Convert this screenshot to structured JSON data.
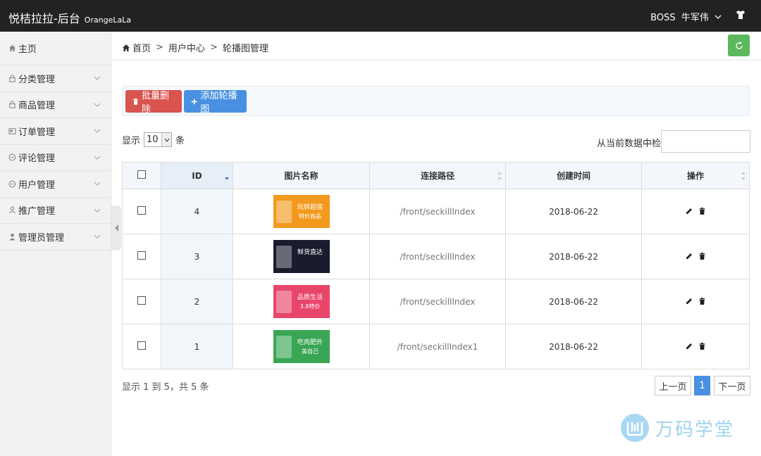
{
  "brand": {
    "title": "悦桔拉拉-后台",
    "subtitle": "OrangeLaLa"
  },
  "user": {
    "role": "BOSS",
    "name": "牛军伟"
  },
  "icons": {
    "shirt": "tshirt-icon",
    "home": "home-icon",
    "lock": "lock-icon",
    "order": "order-icon",
    "comment": "comment-icon",
    "person": "user-icon",
    "refresh": "refresh-icon",
    "trash": "trash-icon",
    "plus": "plus-icon",
    "pencil": "pencil-icon"
  },
  "colors": {
    "topbar": "#222222",
    "danger": "#d9534f",
    "primary": "#4a90e2",
    "success": "#5cb85c",
    "watermark": "#9fd3ee"
  },
  "sidebar": {
    "items": [
      {
        "label": "主页"
      },
      {
        "label": "分类管理"
      },
      {
        "label": "商品管理"
      },
      {
        "label": "订单管理"
      },
      {
        "label": "评论管理"
      },
      {
        "label": "用户管理"
      },
      {
        "label": "推广管理"
      },
      {
        "label": "管理员管理"
      }
    ]
  },
  "breadcrumb": {
    "home": "首页",
    "sep": ">",
    "level1": "用户中心",
    "level2": "轮播图管理"
  },
  "toolbar": {
    "delete_label": "批量删除",
    "add_label": "添加轮播图"
  },
  "length": {
    "prefix": "显示",
    "value": "10",
    "suffix": "条"
  },
  "search": {
    "label": "从当前数据中检索:",
    "value": ""
  },
  "table": {
    "headers": {
      "id": "ID",
      "image": "图片名称",
      "path": "连接路径",
      "created": "创建时间",
      "ops": "操作"
    },
    "rows": [
      {
        "id": "4",
        "path": "/front/seckillIndex",
        "created": "2018-06-22",
        "banner_text": "玩转超值",
        "banner_sub": "特价商品",
        "banner_color": "#f39a1e"
      },
      {
        "id": "3",
        "path": "/front/seckillIndex",
        "created": "2018-06-22",
        "banner_text": "鲜货直达",
        "banner_sub": "",
        "banner_color": "#1b1b2e"
      },
      {
        "id": "2",
        "path": "/front/seckillIndex",
        "created": "2018-06-22",
        "banner_text": "品质生活",
        "banner_sub": "3.8特价",
        "banner_color": "#e8456a"
      },
      {
        "id": "1",
        "path": "/front/seckillIndex1",
        "created": "2018-06-22",
        "banner_text": "吃肉肥外",
        "banner_sub": "美自己",
        "banner_color": "#3aa655"
      }
    ]
  },
  "info": "显示 1 到 5，共 5 条",
  "pagination": {
    "prev": "上一页",
    "current": "1",
    "next": "下一页"
  },
  "watermark": {
    "text": "万码学堂"
  }
}
